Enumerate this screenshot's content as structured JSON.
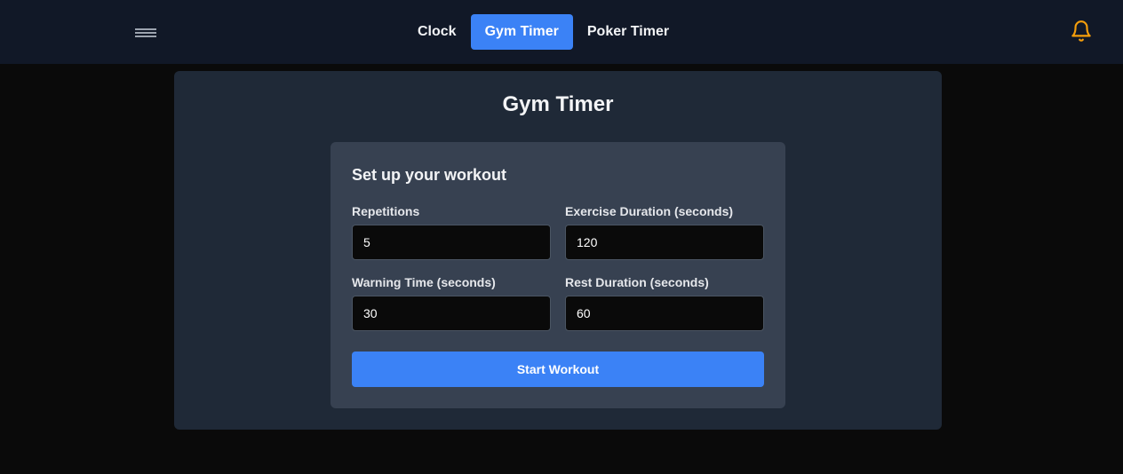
{
  "nav": {
    "menu_icon": "hamburger-menu-icon",
    "tabs": [
      {
        "label": "Clock",
        "active": false
      },
      {
        "label": "Gym Timer",
        "active": true
      },
      {
        "label": "Poker Timer",
        "active": false
      }
    ],
    "notification_icon": "bell-icon"
  },
  "page": {
    "title": "Gym Timer"
  },
  "setup": {
    "heading": "Set up your workout",
    "fields": {
      "repetitions": {
        "label": "Repetitions",
        "value": "5"
      },
      "exercise_duration": {
        "label": "Exercise Duration (seconds)",
        "value": "120"
      },
      "warning_time": {
        "label": "Warning Time (seconds)",
        "value": "30"
      },
      "rest_duration": {
        "label": "Rest Duration (seconds)",
        "value": "60"
      }
    },
    "start_label": "Start Workout"
  },
  "colors": {
    "accent": "#3b82f6",
    "bell": "#f59e0b",
    "topbar": "#111827",
    "panel": "#1f2937",
    "card": "#374151"
  }
}
